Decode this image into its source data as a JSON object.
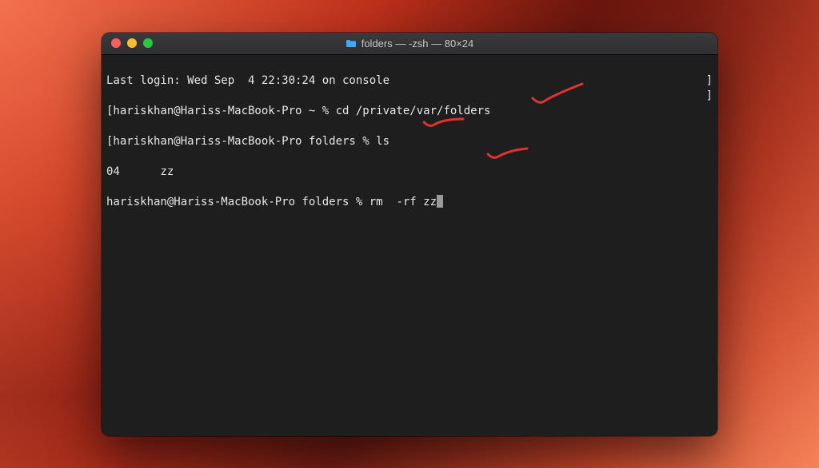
{
  "window": {
    "title": "folders — -zsh — 80×24"
  },
  "terminal": {
    "last_login": "Last login: Wed Sep  4 22:30:24 on console",
    "prompt1_prefix": "[hariskhan@Hariss-MacBook-Pro ~ % ",
    "cmd1": "cd /private/var/folders",
    "prompt2_prefix": "[hariskhan@Hariss-MacBook-Pro folders % ",
    "cmd2": "ls",
    "ls_output": "04      zz",
    "prompt3_prefix": "hariskhan@Hariss-MacBook-Pro folders % ",
    "cmd3": "rm  -rf zz",
    "right_bracket": "]"
  },
  "annotations": {
    "color": "#e2322e"
  }
}
